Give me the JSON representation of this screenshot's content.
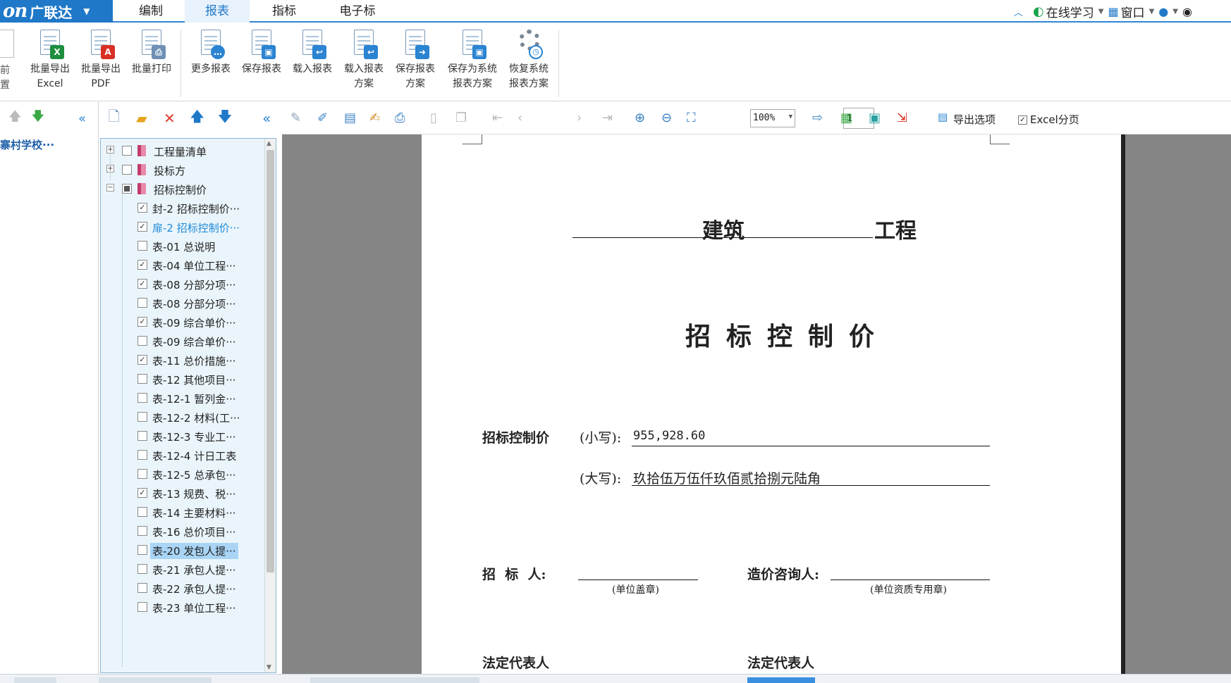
{
  "app": {
    "brand": "广联达",
    "logo_mark": "on"
  },
  "menu": {
    "tabs": [
      {
        "label": "编制"
      },
      {
        "label": "报表"
      },
      {
        "label": "指标"
      },
      {
        "label": "电子标"
      }
    ],
    "active": "报表",
    "right": {
      "online_learning": "在线学习",
      "window": "窗口"
    }
  },
  "ribbon": {
    "partial_left_label_1": "前",
    "partial_left_label_2": "置",
    "buttons": [
      {
        "line1": "批量导出",
        "line2": "Excel",
        "icon": "excel-export-icon"
      },
      {
        "line1": "批量导出",
        "line2": "PDF",
        "icon": "pdf-export-icon"
      },
      {
        "line1": "批量打印",
        "line2": "",
        "icon": "batch-print-icon"
      },
      {
        "line1": "更多报表",
        "line2": "",
        "icon": "more-reports-icon"
      },
      {
        "line1": "保存报表",
        "line2": "",
        "icon": "save-report-icon"
      },
      {
        "line1": "载入报表",
        "line2": "",
        "icon": "load-report-icon"
      },
      {
        "line1": "载入报表",
        "line2": "方案",
        "icon": "load-scheme-icon"
      },
      {
        "line1": "保存报表",
        "line2": "方案",
        "icon": "save-scheme-icon"
      },
      {
        "line1": "保存为系统",
        "line2": "报表方案",
        "icon": "save-system-scheme-icon"
      },
      {
        "line1": "恢复系统",
        "line2": "报表方案",
        "icon": "restore-system-scheme-icon"
      }
    ]
  },
  "left_pane": {
    "project": "寨村学校···"
  },
  "tree": {
    "items": [
      {
        "label": "工程量清单",
        "level": 0,
        "expander": "+",
        "check": "none",
        "book": true
      },
      {
        "label": "投标方",
        "level": 0,
        "expander": "+",
        "check": "none",
        "book": true
      },
      {
        "label": "招标控制价",
        "level": 0,
        "expander": "−",
        "check": "partial",
        "book": true
      },
      {
        "label": "封-2 招标控制价···",
        "level": 1,
        "check": "checked"
      },
      {
        "label": "扉-2 招标控制价···",
        "level": 1,
        "check": "checked",
        "highlight": true
      },
      {
        "label": "表-01 总说明",
        "level": 1,
        "check": "none"
      },
      {
        "label": "表-04 单位工程···",
        "level": 1,
        "check": "checked"
      },
      {
        "label": "表-08 分部分项···",
        "level": 1,
        "check": "checked"
      },
      {
        "label": "表-08 分部分项···",
        "level": 1,
        "check": "none"
      },
      {
        "label": "表-09 综合单价···",
        "level": 1,
        "check": "checked"
      },
      {
        "label": "表-09 综合单价···",
        "level": 1,
        "check": "none"
      },
      {
        "label": "表-11 总价措施···",
        "level": 1,
        "check": "checked"
      },
      {
        "label": "表-12 其他项目···",
        "level": 1,
        "check": "none"
      },
      {
        "label": "表-12-1 暂列金···",
        "level": 1,
        "check": "none"
      },
      {
        "label": "表-12-2 材料(工···",
        "level": 1,
        "check": "none"
      },
      {
        "label": "表-12-3 专业工···",
        "level": 1,
        "check": "none"
      },
      {
        "label": "表-12-4 计日工表",
        "level": 1,
        "check": "none"
      },
      {
        "label": "表-12-5 总承包···",
        "level": 1,
        "check": "none"
      },
      {
        "label": "表-13 规费、税···",
        "level": 1,
        "check": "checked"
      },
      {
        "label": "表-14 主要材料···",
        "level": 1,
        "check": "none"
      },
      {
        "label": "表-16 总价项目···",
        "level": 1,
        "check": "none"
      },
      {
        "label": "表-20 发包人提···",
        "level": 1,
        "check": "none",
        "selected": true
      },
      {
        "label": "表-21 承包人提···",
        "level": 1,
        "check": "none"
      },
      {
        "label": "表-22 承包人提···",
        "level": 1,
        "check": "none"
      },
      {
        "label": "表-23 单位工程···",
        "level": 1,
        "check": "none"
      }
    ]
  },
  "report_toolbar": {
    "page": "1",
    "zoom": "100%",
    "export_options": "导出选项",
    "excel_paging": "Excel分页"
  },
  "document": {
    "project_name": "建筑",
    "project_suffix": "工程",
    "title": "招标控制价",
    "price_label": "招标控制价",
    "lower_label": "(小写):",
    "lower_value": "955,928.60",
    "upper_label": "(大写):",
    "upper_value": "玖拾伍万伍仟玖佰贰拾捌元陆角",
    "tenderer_label": "招  标  人:",
    "tenderer_note": "(单位盖章)",
    "consultant_label": "造价咨询人:",
    "consultant_note": "(单位资质专用章)",
    "legal_rep_1": "法定代表人",
    "legal_rep_2": "法定代表人"
  }
}
